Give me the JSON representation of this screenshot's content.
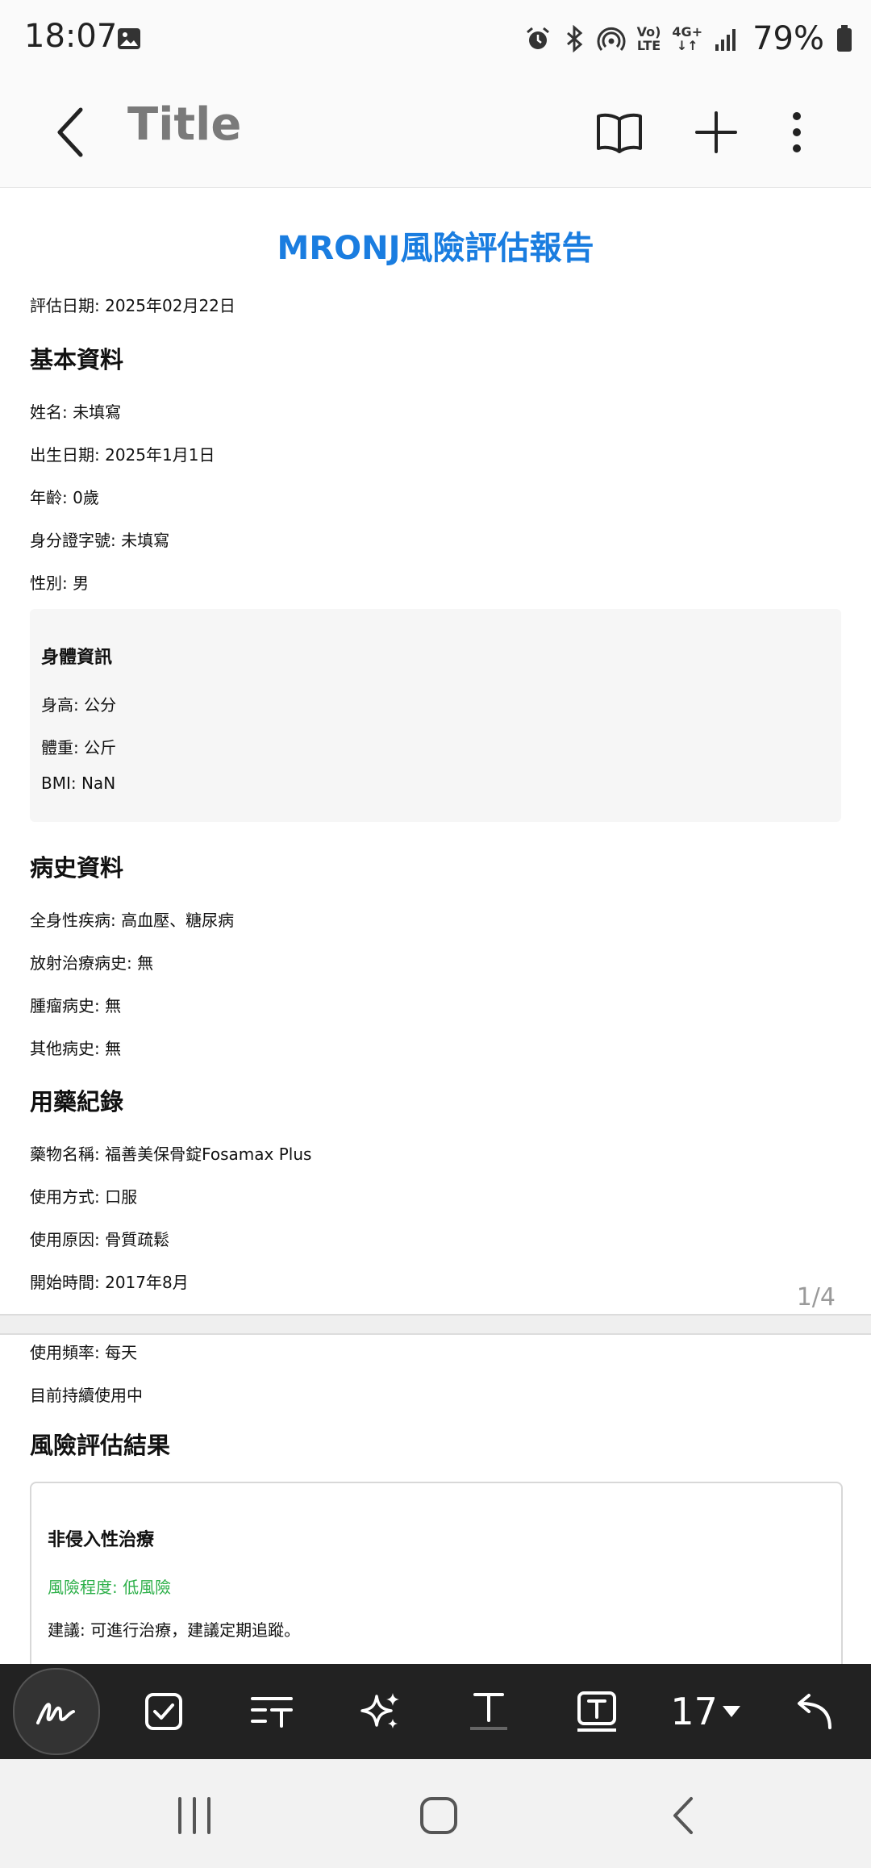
{
  "status_bar": {
    "time": "18:07",
    "network_top": "Vo)",
    "network_bottom": "LTE",
    "network_gen": "4G+",
    "battery": "79%"
  },
  "app_bar": {
    "title": "Title"
  },
  "document": {
    "title": "MRONJ風險評估報告",
    "eval_date": "評估日期: 2025年02月22日",
    "basic_heading": "基本資料",
    "name": "姓名: 未填寫",
    "birth": "出生日期: 2025年1月1日",
    "age": "年齡: 0歲",
    "id": "身分證字號: 未填寫",
    "gender": "性別: 男",
    "body": {
      "heading": "身體資訊",
      "height": "身高: 公分",
      "weight": "體重: 公斤",
      "bmi": "BMI: NaN"
    },
    "history_heading": "病史資料",
    "systemic": "全身性疾病: 高血壓、糖尿病",
    "radiation": "放射治療病史: 無",
    "tumor": "腫瘤病史: 無",
    "other": "其他病史: 無",
    "med_heading": "用藥紀錄",
    "drug_name": "藥物名稱: 福善美保骨錠Fosamax Plus",
    "route": "使用方式: 口服",
    "reason": "使用原因: 骨質疏鬆",
    "start": "開始時間: 2017年8月",
    "page_number": "1/4",
    "frequency": "使用頻率: 每天",
    "ongoing": "目前持續使用中",
    "risk_heading": "風險評估結果",
    "card": {
      "heading": "非侵入性治療",
      "risk_level": "風險程度: 低風險",
      "advice": "建議: 可進行治療，建議定期追蹤。"
    }
  },
  "toolbar": {
    "font_size": "17"
  },
  "colors": {
    "title_blue": "#1a7de0",
    "risk_green": "#2eb04a",
    "toolbar_bg": "#222222"
  }
}
